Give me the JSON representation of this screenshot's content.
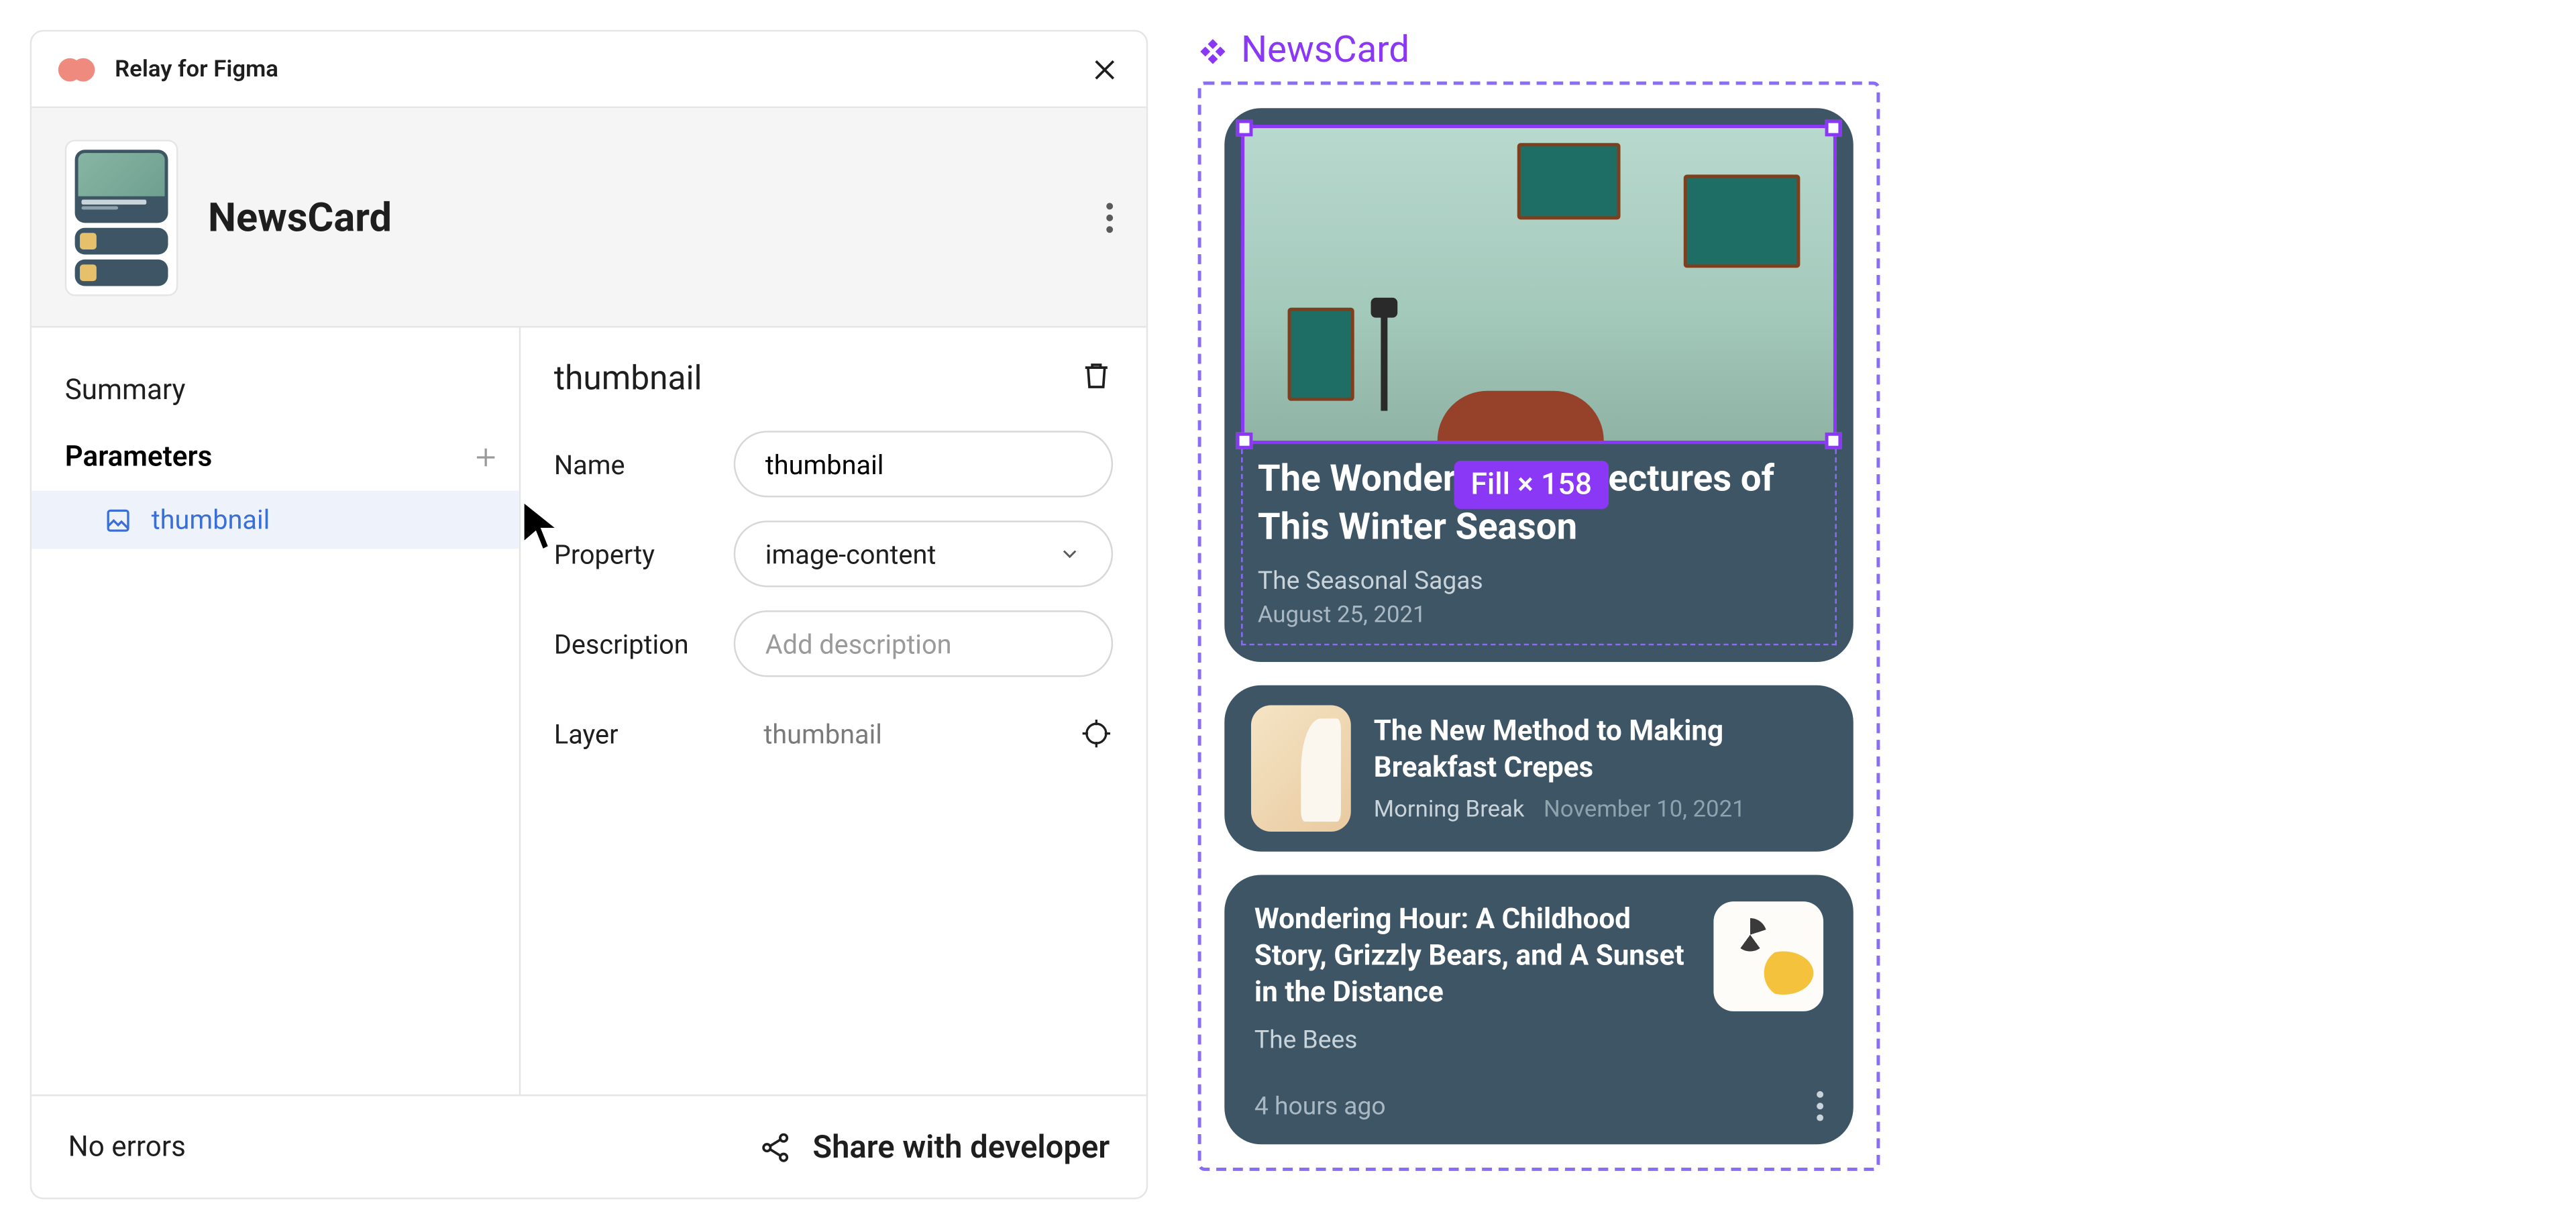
{
  "titlebar": {
    "app_name": "Relay for Figma"
  },
  "header": {
    "component_name": "NewsCard"
  },
  "sidebar": {
    "summary_label": "Summary",
    "parameters_label": "Parameters",
    "params": [
      {
        "name": "thumbnail"
      }
    ]
  },
  "detail": {
    "title": "thumbnail",
    "name_label": "Name",
    "name_value": "thumbnail",
    "property_label": "Property",
    "property_value": "image-content",
    "description_label": "Description",
    "description_placeholder": "Add description",
    "layer_label": "Layer",
    "layer_value": "thumbnail"
  },
  "footer": {
    "status": "No errors",
    "share_label": "Share with developer"
  },
  "canvas": {
    "frame_name": "NewsCard",
    "selection_size_label": "Fill × 158",
    "cards": {
      "hero": {
        "headline": "The Wonderful Architectures of This Winter Season",
        "author": "The Seasonal Sagas",
        "date": "August 25, 2021"
      },
      "second": {
        "headline": "The New Method to Making Breakfast Crepes",
        "author": "Morning Break",
        "date": "November 10, 2021"
      },
      "third": {
        "headline": "Wondering Hour: A Childhood Story, Grizzly Bears, and A Sunset in the Distance",
        "author": "The Bees",
        "relative_time": "4 hours ago"
      }
    }
  }
}
